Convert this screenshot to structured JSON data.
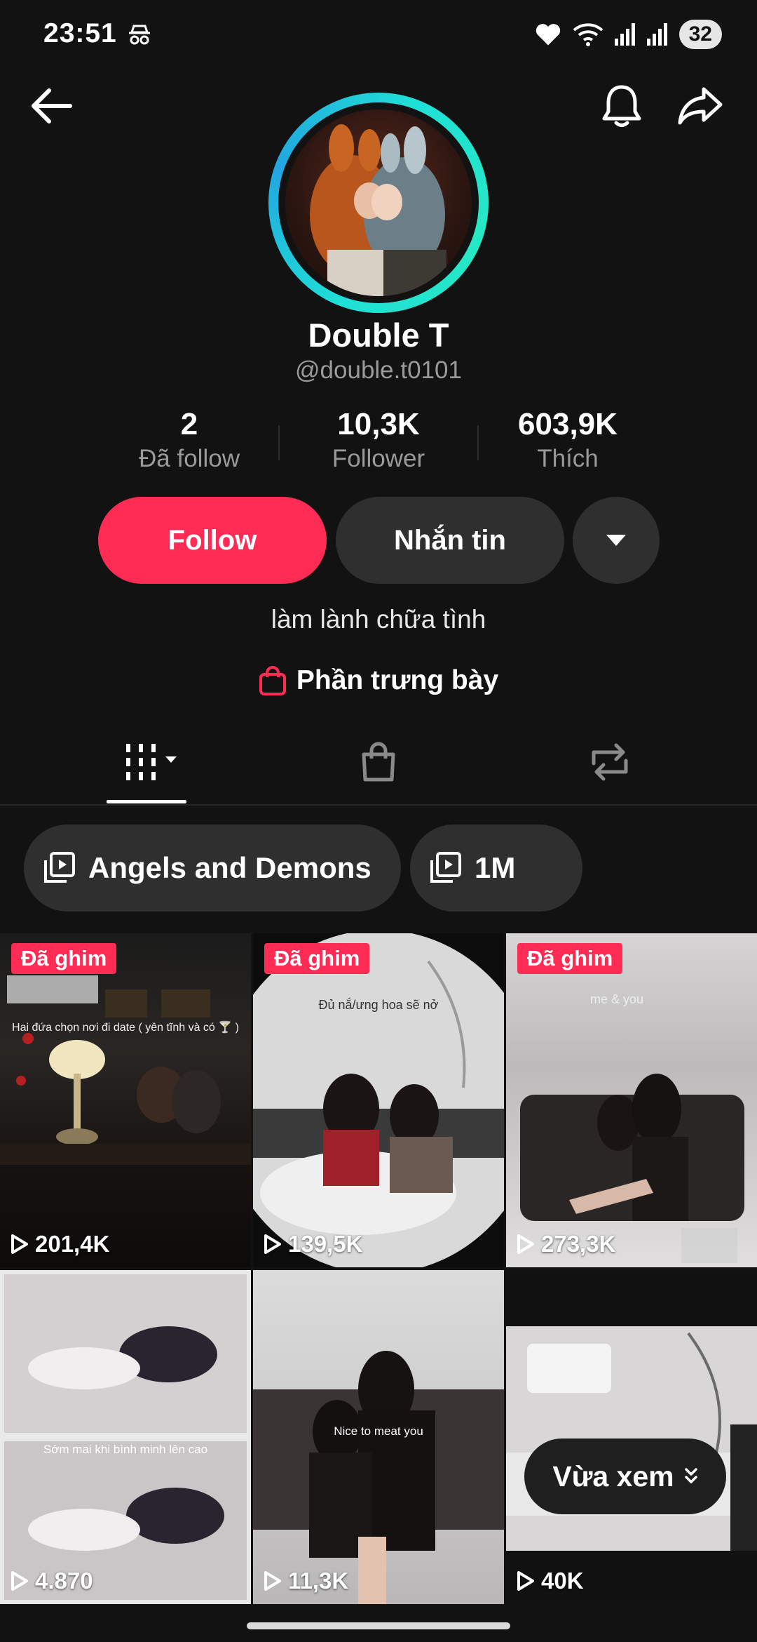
{
  "status_bar": {
    "time": "23:51",
    "battery": "32"
  },
  "profile": {
    "name": "Double T",
    "handle": "@double.t0101",
    "bio": "làm lành chữa tình",
    "showcase_label": "Phần trưng bày"
  },
  "stats": [
    {
      "value": "2",
      "label": "Đã follow"
    },
    {
      "value": "10,3K",
      "label": "Follower"
    },
    {
      "value": "603,9K",
      "label": "Thích"
    }
  ],
  "actions": {
    "follow": "Follow",
    "message": "Nhắn tin"
  },
  "playlists": [
    {
      "label": "Angels and Demons"
    },
    {
      "label": "1M"
    }
  ],
  "videos": [
    {
      "pinned": "Đã ghim",
      "views": "201,4K",
      "caption": "Hai đứa chọn nơi đi date ( yên tĩnh và có 🍸 )"
    },
    {
      "pinned": "Đã ghim",
      "views": "139,5K",
      "caption": "Đủ nắ/ưng hoa sẽ nở"
    },
    {
      "pinned": "Đã ghim",
      "views": "273,3K",
      "caption": "me & you"
    },
    {
      "pinned": "",
      "views": "4.870",
      "caption": "Sớm mai khi bình minh lên cao"
    },
    {
      "pinned": "",
      "views": "11,3K",
      "caption": "Nice to meat you"
    },
    {
      "pinned": "",
      "views": "40K",
      "caption": ""
    }
  ],
  "recently_viewed": "Vừa xem",
  "colors": {
    "accent": "#fe2c55",
    "background": "#121212",
    "ring": "#1fe0d6"
  }
}
